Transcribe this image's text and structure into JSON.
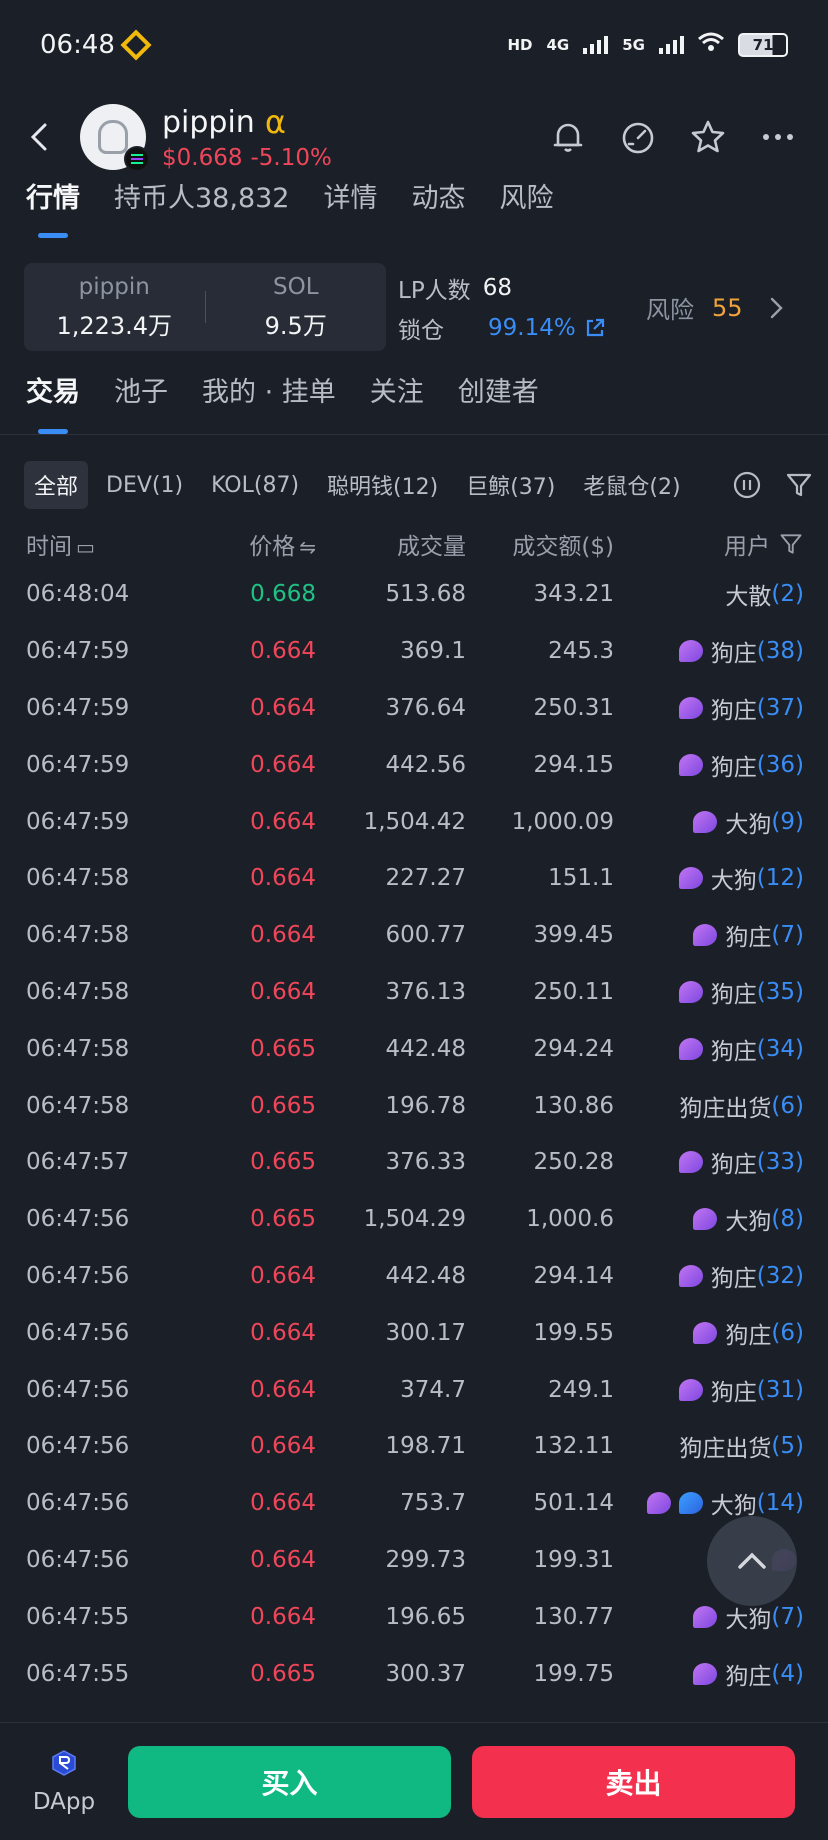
{
  "status_bar": {
    "time": "06:48",
    "hd": "HD",
    "net1": "4G",
    "net2": "5G",
    "battery": "71"
  },
  "token": {
    "name": "pippin",
    "alpha": "α",
    "price": "$0.668",
    "change": "-5.10%"
  },
  "main_tabs": [
    "行情",
    "持币人38,832",
    "详情",
    "动态",
    "风险"
  ],
  "pool": {
    "left_label": "pippin",
    "left_value": "1,223.4万",
    "right_label": "SOL",
    "right_value": "9.5万"
  },
  "lp": {
    "count_label": "LP人数",
    "count_value": "68",
    "lock_label": "锁仓",
    "lock_value": "99.14%"
  },
  "risk": {
    "label": "风险",
    "score": "55"
  },
  "sub_tabs": [
    "交易",
    "池子",
    "我的 · 挂单",
    "关注",
    "创建者"
  ],
  "filters": [
    "全部",
    "DEV(1)",
    "KOL(87)",
    "聪明钱(12)",
    "巨鲸(37)",
    "老鼠仓(2)"
  ],
  "table": {
    "headers": {
      "time": "时间",
      "price": "价格",
      "volume": "成交量",
      "amount": "成交额($)",
      "user": "用户"
    },
    "rows": [
      {
        "time": "06:48:04",
        "price": "0.668",
        "dir": "up",
        "volume": "513.68",
        "amount": "343.21",
        "user": "大散",
        "num": "(2)",
        "icons": []
      },
      {
        "time": "06:47:59",
        "price": "0.664",
        "dir": "down",
        "volume": "369.1",
        "amount": "245.3",
        "user": "狗庄",
        "num": "(38)",
        "icons": [
          "whale-icon"
        ]
      },
      {
        "time": "06:47:59",
        "price": "0.664",
        "dir": "down",
        "volume": "376.64",
        "amount": "250.31",
        "user": "狗庄",
        "num": "(37)",
        "icons": [
          "whale-icon"
        ]
      },
      {
        "time": "06:47:59",
        "price": "0.664",
        "dir": "down",
        "volume": "442.56",
        "amount": "294.15",
        "user": "狗庄",
        "num": "(36)",
        "icons": [
          "whale-icon"
        ]
      },
      {
        "time": "06:47:59",
        "price": "0.664",
        "dir": "down",
        "volume": "1,504.42",
        "amount": "1,000.09",
        "user": "大狗",
        "num": "(9)",
        "icons": [
          "whale-icon"
        ]
      },
      {
        "time": "06:47:58",
        "price": "0.664",
        "dir": "down",
        "volume": "227.27",
        "amount": "151.1",
        "user": "大狗",
        "num": "(12)",
        "icons": [
          "whale-icon"
        ]
      },
      {
        "time": "06:47:58",
        "price": "0.664",
        "dir": "down",
        "volume": "600.77",
        "amount": "399.45",
        "user": "狗庄",
        "num": "(7)",
        "icons": [
          "whale-icon"
        ]
      },
      {
        "time": "06:47:58",
        "price": "0.664",
        "dir": "down",
        "volume": "376.13",
        "amount": "250.11",
        "user": "狗庄",
        "num": "(35)",
        "icons": [
          "whale-icon"
        ]
      },
      {
        "time": "06:47:58",
        "price": "0.665",
        "dir": "down",
        "volume": "442.48",
        "amount": "294.24",
        "user": "狗庄",
        "num": "(34)",
        "icons": [
          "whale-icon"
        ]
      },
      {
        "time": "06:47:58",
        "price": "0.665",
        "dir": "down",
        "volume": "196.78",
        "amount": "130.86",
        "user": "狗庄出货",
        "num": "(6)",
        "icons": []
      },
      {
        "time": "06:47:57",
        "price": "0.665",
        "dir": "down",
        "volume": "376.33",
        "amount": "250.28",
        "user": "狗庄",
        "num": "(33)",
        "icons": [
          "whale-icon"
        ]
      },
      {
        "time": "06:47:56",
        "price": "0.665",
        "dir": "down",
        "volume": "1,504.29",
        "amount": "1,000.6",
        "user": "大狗",
        "num": "(8)",
        "icons": [
          "whale-icon"
        ]
      },
      {
        "time": "06:47:56",
        "price": "0.664",
        "dir": "down",
        "volume": "442.48",
        "amount": "294.14",
        "user": "狗庄",
        "num": "(32)",
        "icons": [
          "whale-icon"
        ]
      },
      {
        "time": "06:47:56",
        "price": "0.664",
        "dir": "down",
        "volume": "300.17",
        "amount": "199.55",
        "user": "狗庄",
        "num": "(6)",
        "icons": [
          "whale-icon"
        ]
      },
      {
        "time": "06:47:56",
        "price": "0.664",
        "dir": "down",
        "volume": "374.7",
        "amount": "249.1",
        "user": "狗庄",
        "num": "(31)",
        "icons": [
          "whale-icon"
        ]
      },
      {
        "time": "06:47:56",
        "price": "0.664",
        "dir": "down",
        "volume": "198.71",
        "amount": "132.11",
        "user": "狗庄出货",
        "num": "(5)",
        "icons": []
      },
      {
        "time": "06:47:56",
        "price": "0.664",
        "dir": "down",
        "volume": "753.7",
        "amount": "501.14",
        "user": "大狗",
        "num": "(14)",
        "icons": [
          "whale-icon",
          "blue-whale-icon"
        ]
      },
      {
        "time": "06:47:56",
        "price": "0.664",
        "dir": "down",
        "volume": "299.73",
        "amount": "199.31",
        "user": "",
        "num": "",
        "icons": [
          "whale-icon"
        ]
      },
      {
        "time": "06:47:55",
        "price": "0.664",
        "dir": "down",
        "volume": "196.65",
        "amount": "130.77",
        "user": "大狗",
        "num": "(7)",
        "icons": [
          "whale-icon"
        ]
      },
      {
        "time": "06:47:55",
        "price": "0.665",
        "dir": "down",
        "volume": "300.37",
        "amount": "199.75",
        "user": "狗庄",
        "num": "(4)",
        "icons": [
          "whale-icon"
        ]
      }
    ]
  },
  "bottom": {
    "dapp_label": "DApp",
    "buy_label": "买入",
    "sell_label": "卖出"
  },
  "colors": {
    "up": "#1fc285",
    "down": "#f0465a",
    "accent": "#3a8df5",
    "buy": "#10b981",
    "sell": "#f4304f",
    "risk": "#f0a33a"
  }
}
